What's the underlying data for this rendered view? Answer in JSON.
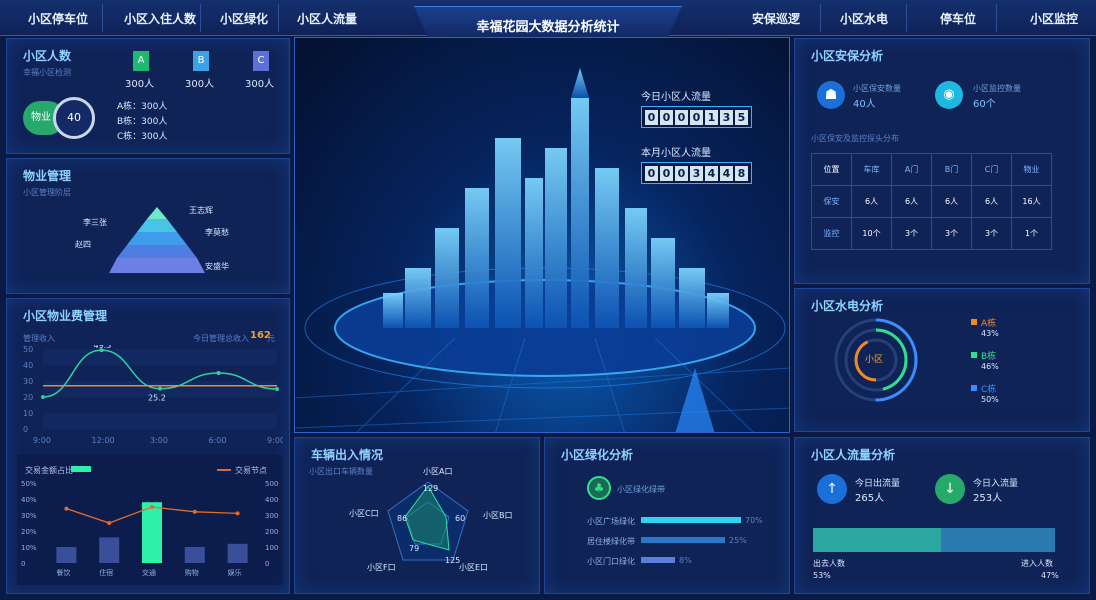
{
  "nav": {
    "left": [
      "小区停车位",
      "小区入住人数",
      "小区绿化",
      "小区人流量"
    ],
    "right": [
      "安保巡逻",
      "小区水电",
      "停车位",
      "小区监控"
    ],
    "title": "幸福花园大数据分析统计"
  },
  "population": {
    "title": "小区人数",
    "subtitle": "幸福小区检测",
    "buildings": [
      {
        "letter": "A",
        "count": "300人"
      },
      {
        "letter": "B",
        "count": "300人"
      },
      {
        "letter": "C",
        "count": "300人"
      }
    ],
    "ring_label": "物业",
    "ring_value": "40",
    "list": [
      "A栋：300人",
      "B栋：300人",
      "C栋：300人"
    ]
  },
  "property": {
    "title": "物业管理",
    "subtitle": "小区管理阶层",
    "names": [
      "王志辉",
      "李三张",
      "李莫愁",
      "赵四",
      "安盛华"
    ]
  },
  "fees": {
    "title": "小区物业费管理",
    "left_label": "管理收入",
    "right_label": "今日管理总收入",
    "right_value": "162",
    "unit": "元",
    "peak": "49.3",
    "low": "25.2",
    "yticks": [
      "50",
      "40",
      "30",
      "20",
      "10",
      "0"
    ],
    "xticks": [
      "9:00",
      "12:00",
      "3:00",
      "6:00",
      "9:00"
    ],
    "bar_legend_left": "交易金额占比",
    "bar_legend_right": "交易节点",
    "bar_left_ticks": [
      "50%",
      "40%",
      "30%",
      "20%",
      "10%",
      "0"
    ],
    "bar_right_ticks": [
      "500",
      "400",
      "300",
      "200",
      "100",
      "0"
    ],
    "categories": [
      "餐饮",
      "住宿",
      "交通",
      "购物",
      "娱乐"
    ]
  },
  "center": {
    "today_label": "今日小区人流量",
    "today_digits": [
      "0",
      "0",
      "0",
      "0",
      "1",
      "3",
      "5"
    ],
    "month_label": "本月小区人流量",
    "month_digits": [
      "0",
      "0",
      "0",
      "3",
      "4",
      "4",
      "8"
    ]
  },
  "security": {
    "title": "小区安保分析",
    "guards_label": "小区保安数量",
    "guards_value": "40人",
    "cams_label": "小区监控数量",
    "cams_value": "60个",
    "dist_label": "小区保安及监控探头分布",
    "header": [
      "位置",
      "车库",
      "A门",
      "B门",
      "C门",
      "物业"
    ],
    "rows": [
      [
        "保安",
        "6人",
        "6人",
        "6人",
        "6人",
        "16人"
      ],
      [
        "监控",
        "10个",
        "3个",
        "3个",
        "3个",
        "1个"
      ]
    ]
  },
  "water": {
    "title": "小区水电分析",
    "center": "小区",
    "items": [
      {
        "name": "A栋",
        "pct": "43%",
        "color": "#f08a24"
      },
      {
        "name": "B栋",
        "pct": "46%",
        "color": "#2fe08e"
      },
      {
        "name": "C栋",
        "pct": "50%",
        "color": "#3a8cff"
      }
    ]
  },
  "vehicles": {
    "title": "车辆出入情况",
    "subtitle": "小区出口车辆数量",
    "axes": [
      "小区A口",
      "小区B口",
      "小区E口",
      "小区F口",
      "小区C口"
    ],
    "values": [
      "129",
      "60",
      "125",
      "79",
      "86"
    ]
  },
  "greening": {
    "title": "小区绿化分析",
    "label": "小区绿化绿带",
    "items": [
      {
        "name": "小区广场绿化",
        "pct": "70%"
      },
      {
        "name": "居住楼绿化带",
        "pct": "25%"
      },
      {
        "name": "小区门口绿化",
        "pct": "8%"
      }
    ]
  },
  "flow": {
    "title": "小区人流量分析",
    "out_label": "今日出流量",
    "out_value": "265人",
    "in_label": "今日入流量",
    "in_value": "253人",
    "out_people": "出去人数",
    "out_pct": "53%",
    "in_people": "进入人数",
    "in_pct": "47%"
  },
  "chart_data": [
    {
      "type": "line",
      "title": "",
      "x": [
        "9:00",
        "12:00",
        "3:00",
        "6:00",
        "9:00"
      ],
      "series": [
        {
          "values": [
            20,
            49.3,
            25.2,
            35,
            25
          ]
        },
        {
          "values": [
            27,
            27,
            27,
            27,
            27
          ]
        }
      ],
      "ylim": [
        0,
        50
      ]
    },
    {
      "type": "bar",
      "categories": [
        "餐饮",
        "住宿",
        "交通",
        "购物",
        "娱乐"
      ],
      "series": [
        {
          "name": "交易金额占比",
          "values": [
            10,
            16,
            38,
            10,
            12
          ]
        },
        {
          "name": "交易节点",
          "values": [
            340,
            250,
            350,
            320,
            310
          ]
        }
      ],
      "ylim": [
        0,
        50
      ]
    }
  ]
}
